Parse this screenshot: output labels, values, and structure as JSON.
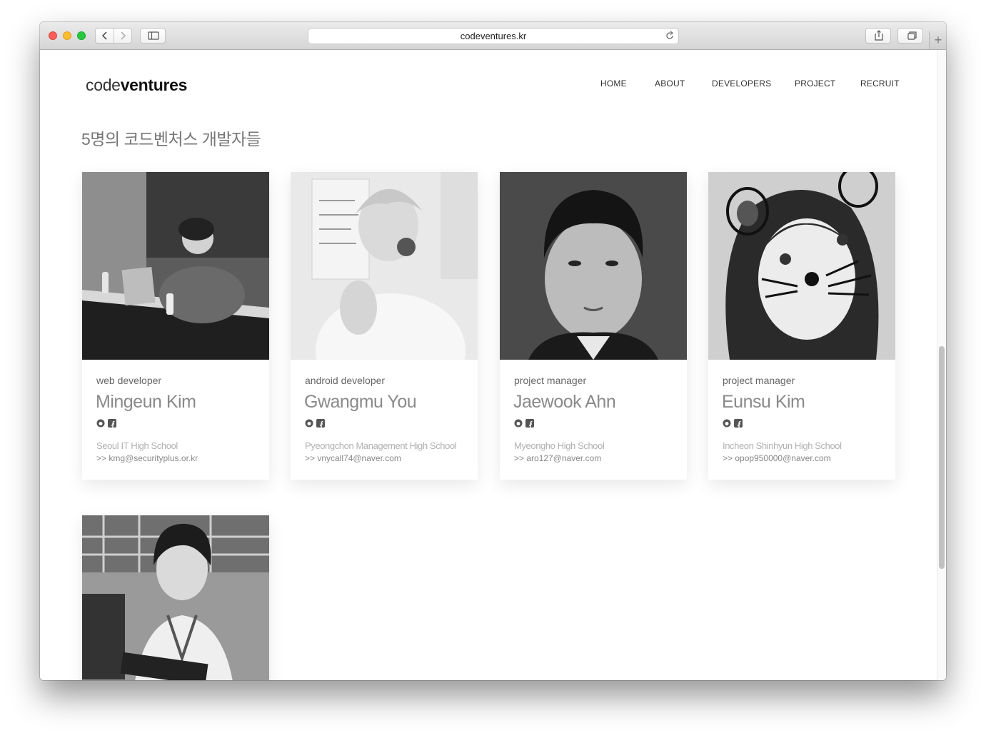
{
  "browser": {
    "url": "codeventures.kr"
  },
  "site": {
    "logo_light": "code",
    "logo_bold": "ventures",
    "nav": [
      "HOME",
      "ABOUT",
      "DEVELOPERS",
      "PROJECT",
      "RECRUIT"
    ],
    "section_title": "5명의 코드벤처스 개발자들"
  },
  "developers": [
    {
      "role": "web developer",
      "name": "Mingeun Kim",
      "school": "Seoul IT High School",
      "email": ">> kmg@securityplus.or.kr"
    },
    {
      "role": "android developer",
      "name": "Gwangmu You",
      "school": "Pyeongchon Management High School",
      "email": ">> vnycall74@naver.com"
    },
    {
      "role": "project manager",
      "name": "Jaewook Ahn",
      "school": "Myeongho High School",
      "email": ">> aro127@naver.com"
    },
    {
      "role": "project manager",
      "name": "Eunsu Kim",
      "school": "Incheon Shinhyun High School",
      "email": ">> opop950000@naver.com"
    }
  ],
  "icons": {
    "github": "github-icon",
    "facebook": "facebook-icon"
  },
  "colors": {
    "traffic_red": "#fc5f57",
    "traffic_yellow": "#fdbc2e",
    "traffic_green": "#28c840"
  }
}
